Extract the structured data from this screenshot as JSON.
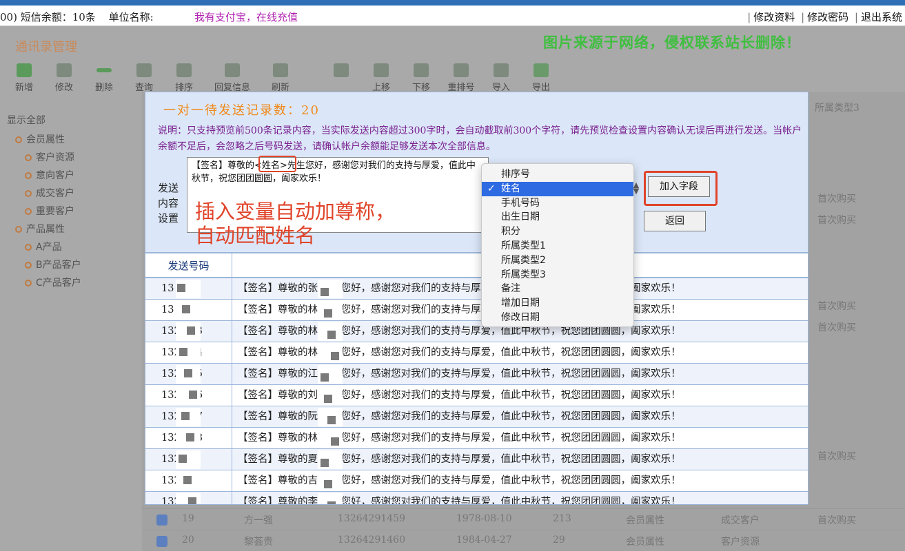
{
  "infobar": {
    "sms_balance": "00) 短信余额：10条",
    "unit_name": "单位名称:",
    "pay_link": "我有支付宝，在线充值",
    "links": [
      "修改资料",
      "修改密码",
      "退出系统"
    ]
  },
  "background": {
    "title": "通讯录管理",
    "watermark": "图片来源于网络，侵权联系站长删除！",
    "toolbar": [
      "新增",
      "修改",
      "删除",
      "查询",
      "排序",
      "回复信息",
      "刷新",
      "",
      "上移",
      "下移",
      "重排号",
      "导入",
      "导出"
    ],
    "sidebar": [
      "显示全部",
      "会员属性",
      "客户资源",
      "意向客户",
      "成交客户",
      "重要客户",
      "产品属性",
      "A产品",
      "B产品客户",
      "C产品客户"
    ],
    "column_header": "所属类型3",
    "right_col_values": [
      "首次购买",
      "首次购买",
      "首次购买",
      "首次购买",
      "首次购买"
    ],
    "bottom_rows": [
      {
        "no": "19",
        "name": "方一强",
        "phone": "13264291459",
        "date": "1978-08-10",
        "points": "213",
        "type1": "会员属性",
        "type2": "成交客户",
        "type3": "首次购买"
      },
      {
        "no": "20",
        "name": "黎荟贵",
        "phone": "13264291460",
        "date": "1984-04-27",
        "points": "29",
        "type1": "会员属性",
        "type2": "客户资源",
        "type3": ""
      }
    ]
  },
  "modal": {
    "title": "一对一待发送记录数：",
    "count": "20",
    "description": "说明：只支持预览前500条记录内容，当实际发送内容超过300字时，会自动截取前300个字符，请先预览检查设置内容确认无误后再进行发送。当帐户余额不足后，会忽略之后号码发送，请确认帐户余额能足够发送本次全部信息。",
    "send_label": "发送内容设置",
    "content_prefix": "【签名】尊敬的",
    "content_var": "<姓名>",
    "content_suffix": "先生您好，感谢您对我们的支持与厚爱，值此中秋节，祝您团团圆圆，阖家欢乐！",
    "annotation_line1": "插入变量自动加尊称，",
    "annotation_line2": "自动匹配姓名",
    "add_field_button": "加入字段",
    "back_button": "返回",
    "field_select": {
      "selected": "姓名",
      "options": [
        "排序号",
        "姓名",
        "手机号码",
        "出生日期",
        "积分",
        "所属类型1",
        "所属类型2",
        "所属类型3",
        "备注",
        "增加日期",
        "修改日期"
      ]
    },
    "table": {
      "header": "发送号码",
      "rows": [
        {
          "number": "13 441",
          "message": "【签名】尊敬的张    先生您好，感谢您对我们的支持与厚爱，值此中秋节，祝您团团圆圆，阖家欢乐！"
        },
        {
          "number": "13 442",
          "message": "【签名】尊敬的林    先生您好，感谢您对我们的支持与厚爱，值此中秋节，祝您团团圆圆，阖家欢乐！"
        },
        {
          "number": "132 443",
          "message": "【签名】尊敬的林    先生您好，感谢您对我们的支持与厚爱，值此中秋节，祝您团团圆圆，阖家欢乐！"
        },
        {
          "number": "132 444",
          "message": "【签名】尊敬的林    先生您好，感谢您对我们的支持与厚爱，值此中秋节，祝您团团圆圆，阖家欢乐！"
        },
        {
          "number": "132 445",
          "message": "【签名】尊敬的江    先生您好，感谢您对我们的支持与厚爱，值此中秋节，祝您团团圆圆，阖家欢乐！"
        },
        {
          "number": "132 446",
          "message": "【签名】尊敬的刘    先生您好，感谢您对我们的支持与厚爱，值此中秋节，祝您团团圆圆，阖家欢乐！"
        },
        {
          "number": "132 447",
          "message": "【签名】尊敬的阮    先生您好，感谢您对我们的支持与厚爱，值此中秋节，祝您团团圆圆，阖家欢乐！"
        },
        {
          "number": "132 448",
          "message": "【签名】尊敬的林    先生您好，感谢您对我们的支持与厚爱，值此中秋节，祝您团团圆圆，阖家欢乐！"
        },
        {
          "number": "132 49",
          "message": "【签名】尊敬的夏    先生您好，感谢您对我们的支持与厚爱，值此中秋节，祝您团团圆圆，阖家欢乐！"
        },
        {
          "number": "132 50",
          "message": "【签名】尊敬的吉    先生您好，感谢您对我们的支持与厚爱，值此中秋节，祝您团团圆圆，阖家欢乐！"
        },
        {
          "number": "132 51",
          "message": "【签名】尊敬的李    先生您好，感谢您对我们的支持与厚爱，值此中秋节，祝您团团圆圆，阖家欢乐！"
        }
      ]
    }
  }
}
